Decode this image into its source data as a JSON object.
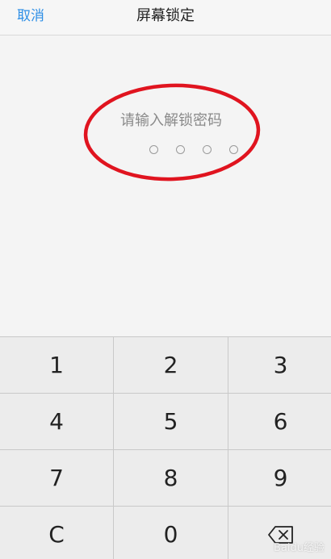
{
  "header": {
    "cancel_label": "取消",
    "title": "屏幕锁定"
  },
  "passcode": {
    "prompt": "请输入解锁密码",
    "digits_entered": 0,
    "digits_total": 4
  },
  "keypad": {
    "keys": [
      "1",
      "2",
      "3",
      "4",
      "5",
      "6",
      "7",
      "8",
      "9",
      "C",
      "0"
    ],
    "backspace_icon": "backspace-icon"
  },
  "annotation": {
    "color": "#e0141f"
  },
  "watermark": {
    "text": "Baidu经验"
  },
  "colors": {
    "accent": "#2e8fe6",
    "key_background": "#ececec",
    "page_background": "#f4f4f4"
  }
}
